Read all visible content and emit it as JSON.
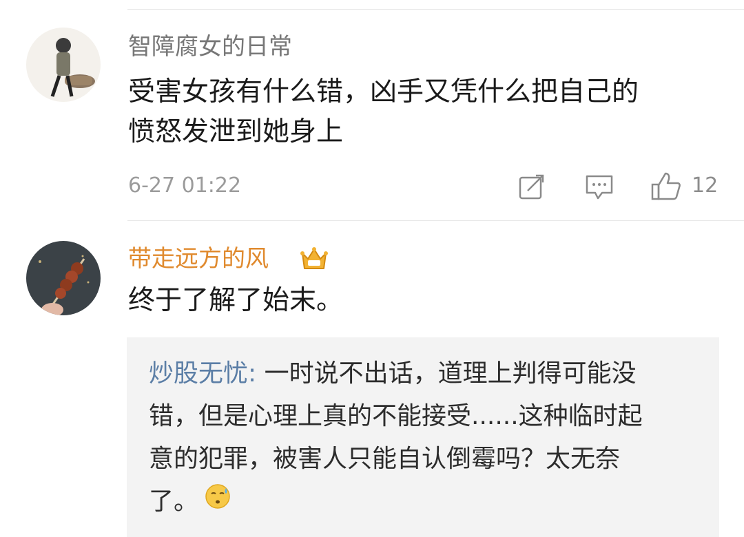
{
  "comments": [
    {
      "username": "智障腐女的日常",
      "text_line1": "受害女孩有什么错，凶手又凭什么把自己的",
      "text_line2": "愤怒发泄到她身上",
      "timestamp": "6-27 01:22",
      "like_count": "12",
      "icons": [
        "share-icon",
        "comment-icon",
        "thumbs-up-icon"
      ]
    },
    {
      "username": "带走远方的风",
      "username_color": "#e08a2e",
      "badge_icon": "crown-badge-icon",
      "text": "终于了解了始末。",
      "reply": {
        "user": "炒股无忧:",
        "line1": " 一时说不出话，道理上判得可能没",
        "line2": "错，但是心理上真的不能接受......这种临时起",
        "line3": "意的犯罪，被害人只能自认倒霉吗？太无奈",
        "line4": "了。",
        "emoji": "sweat-face-emoji"
      }
    }
  ]
}
